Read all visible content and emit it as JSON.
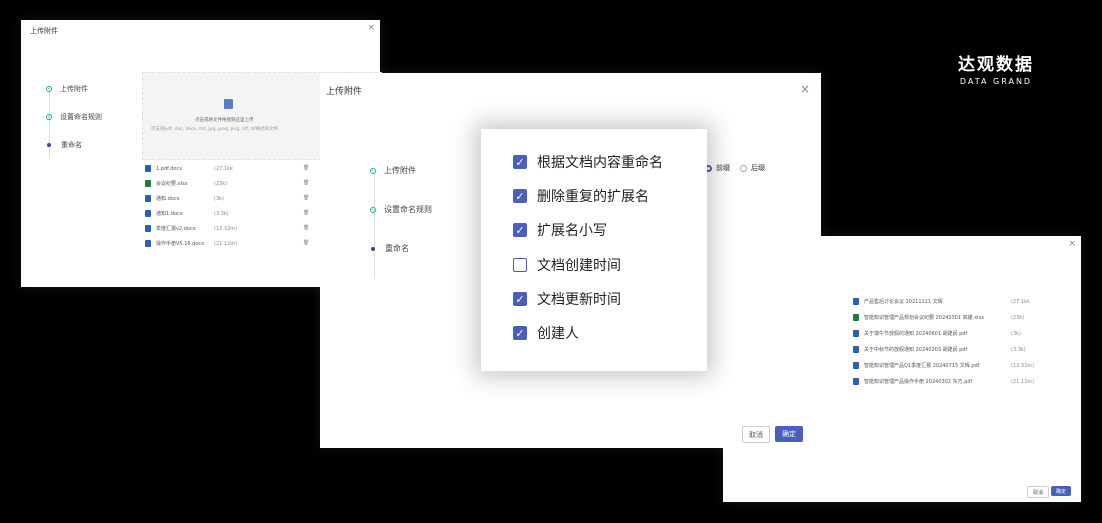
{
  "brand": {
    "name": "达观数据",
    "sub": "DATA GRAND"
  },
  "panel_left": {
    "title": "上传附件",
    "close": "×",
    "steps": [
      "上传附件",
      "设置命名规则",
      "重命名"
    ],
    "upload": {
      "text": "点击或将文件拖拽到这里上传",
      "hint": "可支持pdf, doc, docx, txt, jpg, jpeg, png, tiff, tif格式的文件"
    },
    "files": [
      {
        "name": "1.pdf.docx",
        "size": "(27.1kk",
        "type": "word"
      },
      {
        "name": "会议纪要.xlsx",
        "size": "(23k)",
        "type": "excel"
      },
      {
        "name": "通知.docx",
        "size": "(3k)",
        "type": "word"
      },
      {
        "name": "通知1.docx",
        "size": "(3.3k)",
        "type": "word"
      },
      {
        "name": "季度汇报v2.docx",
        "size": "(12.32m)",
        "type": "word"
      },
      {
        "name": "操作手册V5.16.docx",
        "size": "(21.12m)",
        "type": "word"
      }
    ]
  },
  "panel_mid": {
    "title": "上传附件",
    "close": "×",
    "steps": [
      "上传附件",
      "设置命名规则",
      "重命名"
    ],
    "radios": [
      "前缀",
      "后缀"
    ],
    "cancel": "取消",
    "ok": "确定",
    "options": [
      {
        "label": "根据文档内容重命名",
        "checked": true
      },
      {
        "label": "删除重复的扩展名",
        "checked": true
      },
      {
        "label": "扩展名小写",
        "checked": true
      },
      {
        "label": "文档创建时间",
        "checked": false
      },
      {
        "label": "文档更新时间",
        "checked": true
      },
      {
        "label": "创建人",
        "checked": true
      }
    ]
  },
  "panel_right": {
    "close": "×",
    "cancel": "取消",
    "ok": "确定",
    "files": [
      {
        "name": "产品售后讨论会议 20211121 文辉",
        "size": "(27.1kk",
        "type": "word"
      },
      {
        "name": "智能知识管理产品规划会议纪要 20240301 高雄.xlsx",
        "size": "(23k)",
        "type": "excel"
      },
      {
        "name": "关于端午节放假的通知 20240601 胡建民.pdf",
        "size": "(3k)",
        "type": "pdf"
      },
      {
        "name": "关于中秋节的放假通知 20240203 胡建民.pdf",
        "size": "(3.3k)",
        "type": "pdf"
      },
      {
        "name": "智能知识管理产品Q1季度汇报 20240715 文辉.pdf",
        "size": "(12.32m)",
        "type": "pdf"
      },
      {
        "name": "智能知识管理产品操作手册 20240302 东方.pdf",
        "size": "(21.12m)",
        "type": "pdf"
      }
    ]
  }
}
